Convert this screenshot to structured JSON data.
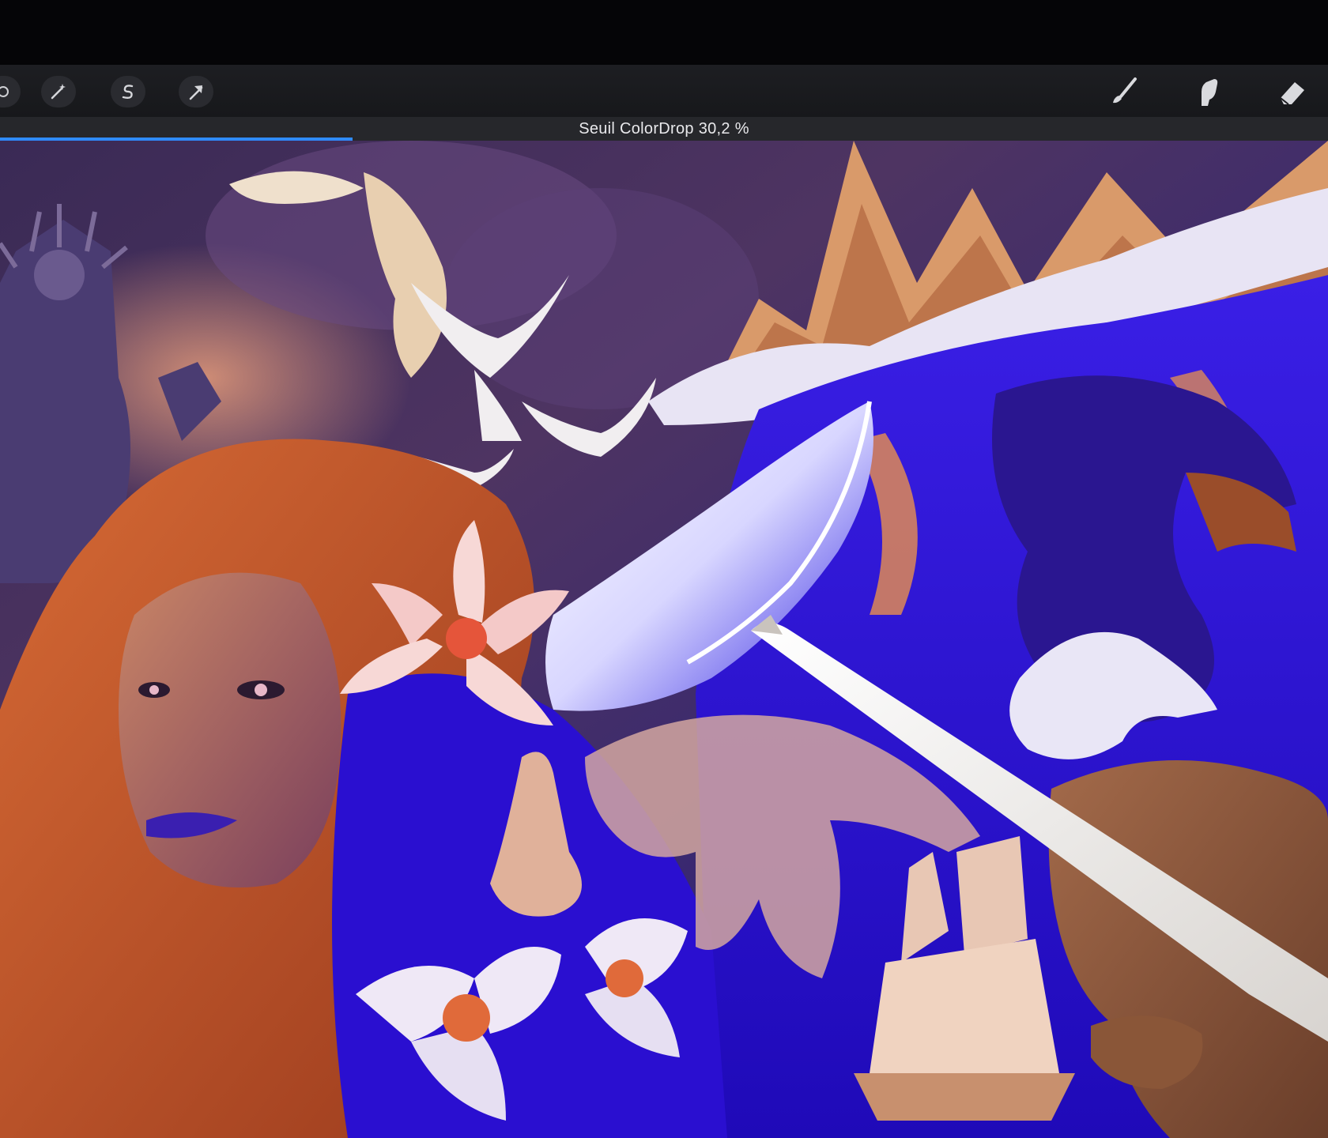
{
  "app": {
    "tools_left": [
      {
        "name": "adjustments",
        "icon": "magic-wand-icon"
      },
      {
        "name": "selection",
        "icon": "selection-s-icon"
      },
      {
        "name": "transform",
        "icon": "transform-arrow-icon"
      }
    ],
    "tools_right": [
      {
        "name": "brush",
        "icon": "brush-icon"
      },
      {
        "name": "smudge",
        "icon": "smudge-icon"
      },
      {
        "name": "eraser",
        "icon": "eraser-icon"
      }
    ]
  },
  "status": {
    "text": "Seuil ColorDrop 30,2 %",
    "threshold_percent": 30.2
  },
  "colors": {
    "accent_blue": "#2f8bff",
    "toolbar_bg": "#1d1e22",
    "canvas_blue": "#2a12d8",
    "canvas_orange": "#e07a3c"
  }
}
